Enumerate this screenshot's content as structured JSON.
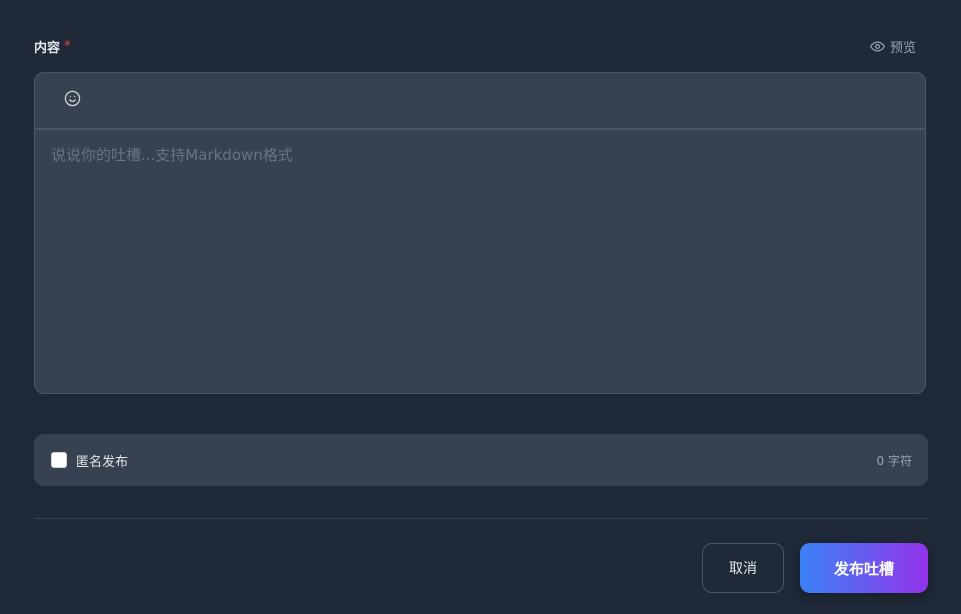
{
  "content_field": {
    "label": "内容",
    "required_mark": "*",
    "preview_label": "预览",
    "preview_icon": "eye-icon"
  },
  "editor": {
    "toolbar": {
      "emoji_icon": "smiley-icon"
    },
    "placeholder": "说说你的吐槽...支持Markdown格式",
    "value": ""
  },
  "options": {
    "anonymous_label": "匿名发布",
    "anonymous_checked": false,
    "char_count": "0 字符"
  },
  "actions": {
    "cancel_label": "取消",
    "submit_label": "发布吐槽"
  },
  "colors": {
    "background": "#1f2937",
    "panel": "#374151",
    "required": "#ef4444",
    "submit_gradient_start": "#3b82f6",
    "submit_gradient_end": "#9333ea"
  }
}
